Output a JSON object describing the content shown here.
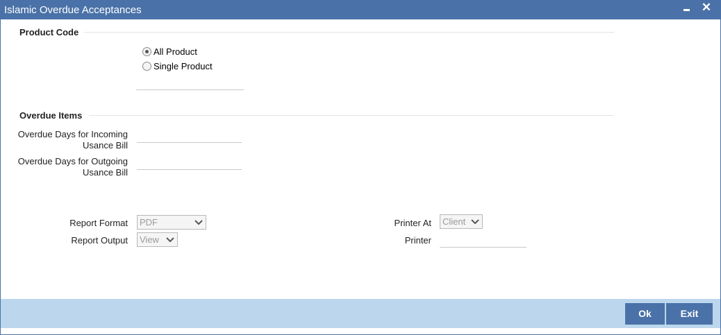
{
  "window": {
    "title": "Islamic Overdue Acceptances",
    "close_glyph": "✕"
  },
  "product_code": {
    "heading": "Product Code",
    "options": [
      {
        "label": "All Product",
        "checked": true
      },
      {
        "label": "Single Product",
        "checked": false
      }
    ],
    "product_value": ""
  },
  "overdue_items": {
    "heading": "Overdue Items",
    "incoming_label_line1": "Overdue Days for Incoming",
    "incoming_label_line2": "Usance Bill",
    "incoming_value": "",
    "outgoing_label_line1": "Overdue Days for Outgoing",
    "outgoing_label_line2": "Usance Bill",
    "outgoing_value": ""
  },
  "report": {
    "format_label": "Report Format",
    "format_value": "PDF",
    "output_label": "Report Output",
    "output_value": "View",
    "printer_at_label": "Printer At",
    "printer_at_value": "Client",
    "printer_label": "Printer",
    "printer_value": ""
  },
  "footer": {
    "ok_label": "Ok",
    "exit_label": "Exit"
  },
  "colors": {
    "title_bar": "#4a72a8",
    "footer_bar": "#bcd7ed",
    "button": "#4a72a8"
  }
}
